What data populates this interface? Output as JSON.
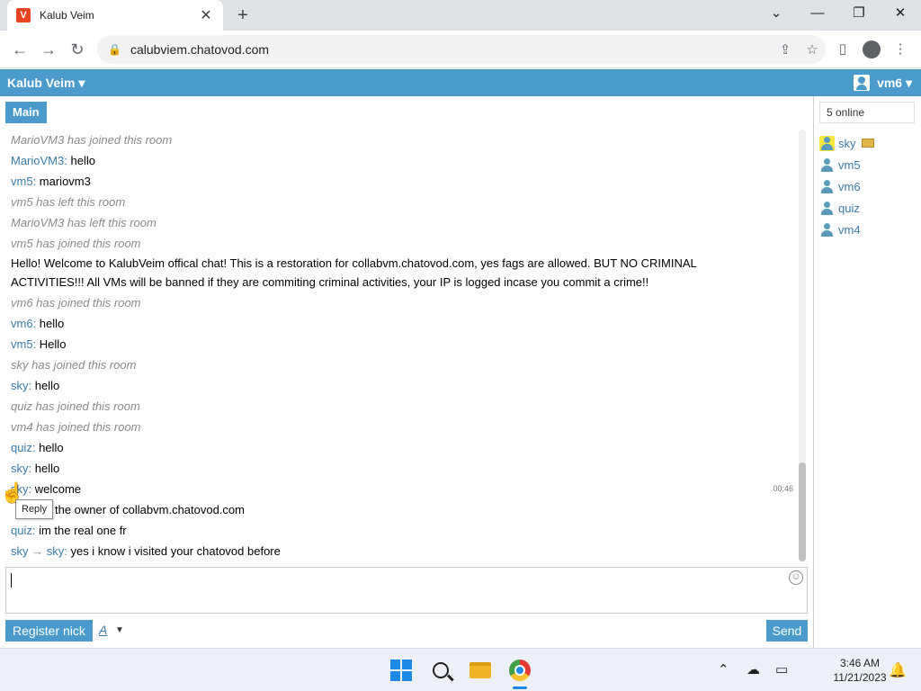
{
  "browser": {
    "tab_title": "Kalub Veim",
    "tab_favicon_text": "V",
    "url": "calubviem.chatovod.com",
    "accent": "#4a9bcb"
  },
  "app": {
    "title": "Kalub Veim ▾",
    "current_user": "vm6 ▾",
    "room_tab": "Main",
    "online_count": "5 online"
  },
  "messages": [
    {
      "type": "sys",
      "text": "MarioVM3 has joined this room"
    },
    {
      "type": "msg",
      "nick": "MarioVM3",
      "text": "hello"
    },
    {
      "type": "msg",
      "nick": "vm5",
      "text": "mariovm3"
    },
    {
      "type": "sys",
      "text": "vm5 has left this room"
    },
    {
      "type": "sys",
      "text": "MarioVM3 has left this room"
    },
    {
      "type": "sys",
      "text": "vm5 has joined this room"
    },
    {
      "type": "announce",
      "text": "Hello! Welcome to KalubVeim offical chat! This is a restoration for collabvm.chatovod.com, yes fags are allowed. BUT NO CRIMINAL ACTIVITIES!!! All VMs will be banned if they are commiting criminal activities, your IP is logged incase you commit a crime!!"
    },
    {
      "type": "sys",
      "text": "vm6 has joined this room"
    },
    {
      "type": "msg",
      "nick": "vm6",
      "text": "hello"
    },
    {
      "type": "msg",
      "nick": "vm5",
      "text": "Hello"
    },
    {
      "type": "sys",
      "text": "sky has joined this room"
    },
    {
      "type": "msg",
      "nick": "sky",
      "text": "hello"
    },
    {
      "type": "sys",
      "text": "quiz has joined this room"
    },
    {
      "type": "sys",
      "text": "vm4 has joined this room"
    },
    {
      "type": "msg",
      "nick": "quiz",
      "text": "hello"
    },
    {
      "type": "msg",
      "nick": "sky",
      "text": "hello"
    },
    {
      "type": "msg",
      "nick": "sky",
      "text": "welcome",
      "time": "00:46"
    },
    {
      "type": "msg",
      "nick": "",
      "text": "the owner of collabvm.chatovod.com"
    },
    {
      "type": "msg",
      "nick": "quiz",
      "text": "im the real one fr"
    },
    {
      "type": "pm",
      "nick": "sky",
      "target": "sky",
      "text": "yes i know i visited your chatovod before"
    }
  ],
  "tooltip": "Reply",
  "controls": {
    "register": "Register nick",
    "font": "A",
    "send": "Send"
  },
  "users": [
    {
      "name": "sky",
      "owner": true
    },
    {
      "name": "vm5",
      "owner": false
    },
    {
      "name": "vm6",
      "owner": false
    },
    {
      "name": "quiz",
      "owner": false
    },
    {
      "name": "vm4",
      "owner": false
    }
  ],
  "taskbar": {
    "time": "3:46 AM",
    "date": "11/21/2023"
  }
}
